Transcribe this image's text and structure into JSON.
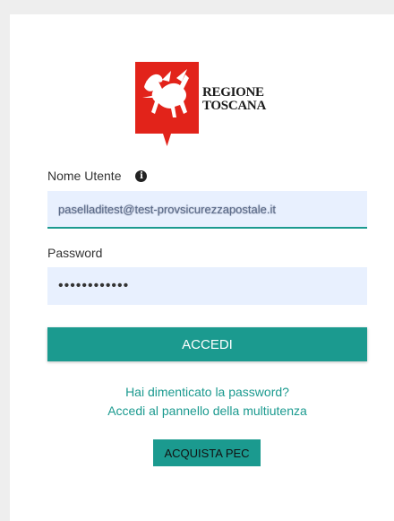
{
  "logo": {
    "line1": "REGIONE",
    "line2": "TOSCANA",
    "emblem": "pegasus-shield-icon",
    "emblem_color": "#e2231a"
  },
  "form": {
    "username_label": "Nome Utente",
    "username_info_icon": "info-icon",
    "username_value": "paselladitest@test-provsicurezzapostale.it",
    "password_label": "Password",
    "password_value": "••••••••••••",
    "login_button": "ACCEDI",
    "accent_color": "#1b9a8f"
  },
  "links": {
    "forgot_password": "Hai dimenticato la password?",
    "multiuser_panel": "Accedi al pannello della multiutenza"
  },
  "actions": {
    "buy_pec": "ACQUISTA PEC"
  }
}
